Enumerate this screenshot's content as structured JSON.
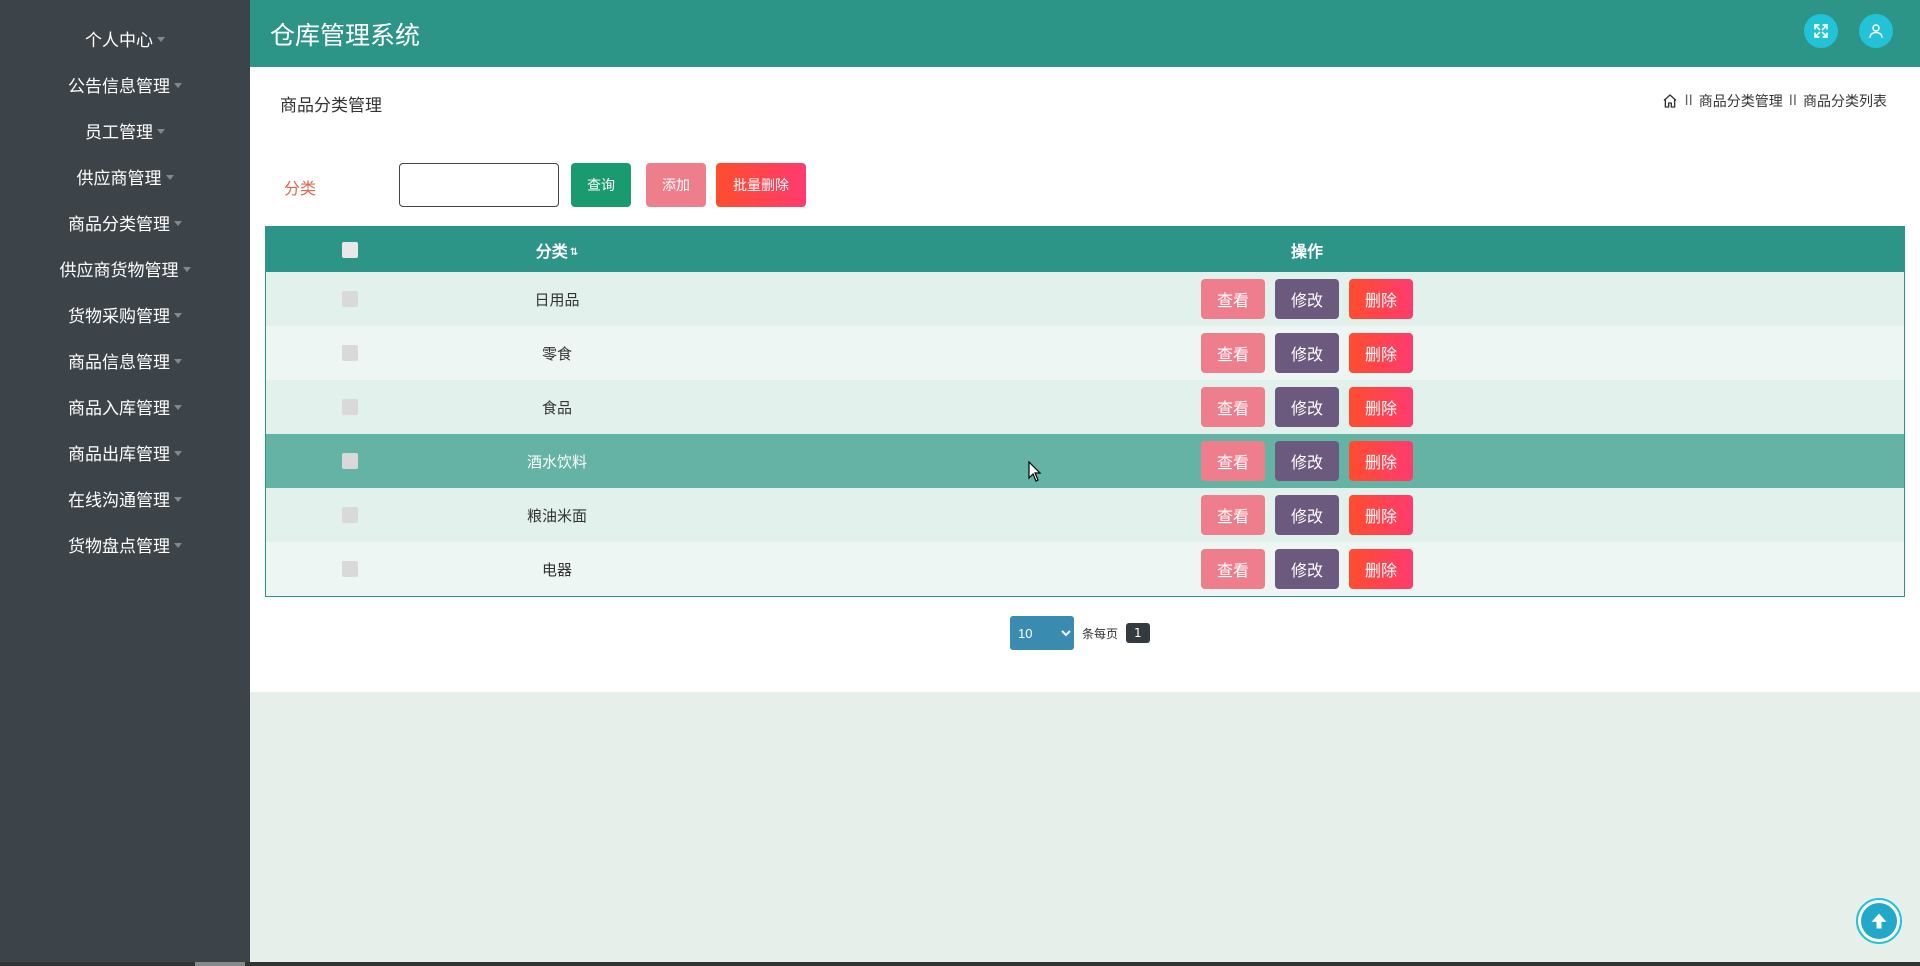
{
  "app": {
    "title": "仓库管理系统"
  },
  "sidebar": {
    "items": [
      {
        "label": "个人中心"
      },
      {
        "label": "公告信息管理"
      },
      {
        "label": "员工管理"
      },
      {
        "label": "供应商管理"
      },
      {
        "label": "商品分类管理"
      },
      {
        "label": "供应商货物管理"
      },
      {
        "label": "货物采购管理"
      },
      {
        "label": "商品信息管理"
      },
      {
        "label": "商品入库管理"
      },
      {
        "label": "商品出库管理"
      },
      {
        "label": "在线沟通管理"
      },
      {
        "label": "货物盘点管理"
      }
    ]
  },
  "header": {
    "fullscreen_icon": "expand-icon",
    "user_icon": "user-icon"
  },
  "page": {
    "title": "商品分类管理",
    "breadcrumb": {
      "home_icon": "home-icon",
      "separator": "II",
      "items": [
        "商品分类管理",
        "商品分类列表"
      ]
    }
  },
  "search": {
    "label": "分类",
    "value": "",
    "placeholder": "",
    "query_label": "查询",
    "add_label": "添加",
    "batch_delete_label": "批量删除"
  },
  "table": {
    "columns": {
      "category": "分类",
      "sort_icon": "⇅",
      "actions": "操作"
    },
    "rows": [
      {
        "name": "日用品"
      },
      {
        "name": "零食"
      },
      {
        "name": "食品"
      },
      {
        "name": "酒水饮料"
      },
      {
        "name": "粮油米面"
      },
      {
        "name": "电器"
      }
    ],
    "actions": {
      "view": "查看",
      "edit": "修改",
      "delete": "删除"
    }
  },
  "pager": {
    "page_size": "10",
    "page_size_options": [
      "10"
    ],
    "per_page_label": "条每页",
    "current_page": "1"
  },
  "colors": {
    "header": "#2d9488",
    "sidebar": "#3d4449",
    "view_button": "#ee7e8c",
    "edit_button": "#6c5a7e",
    "delete_button": "#ff4d2e"
  }
}
